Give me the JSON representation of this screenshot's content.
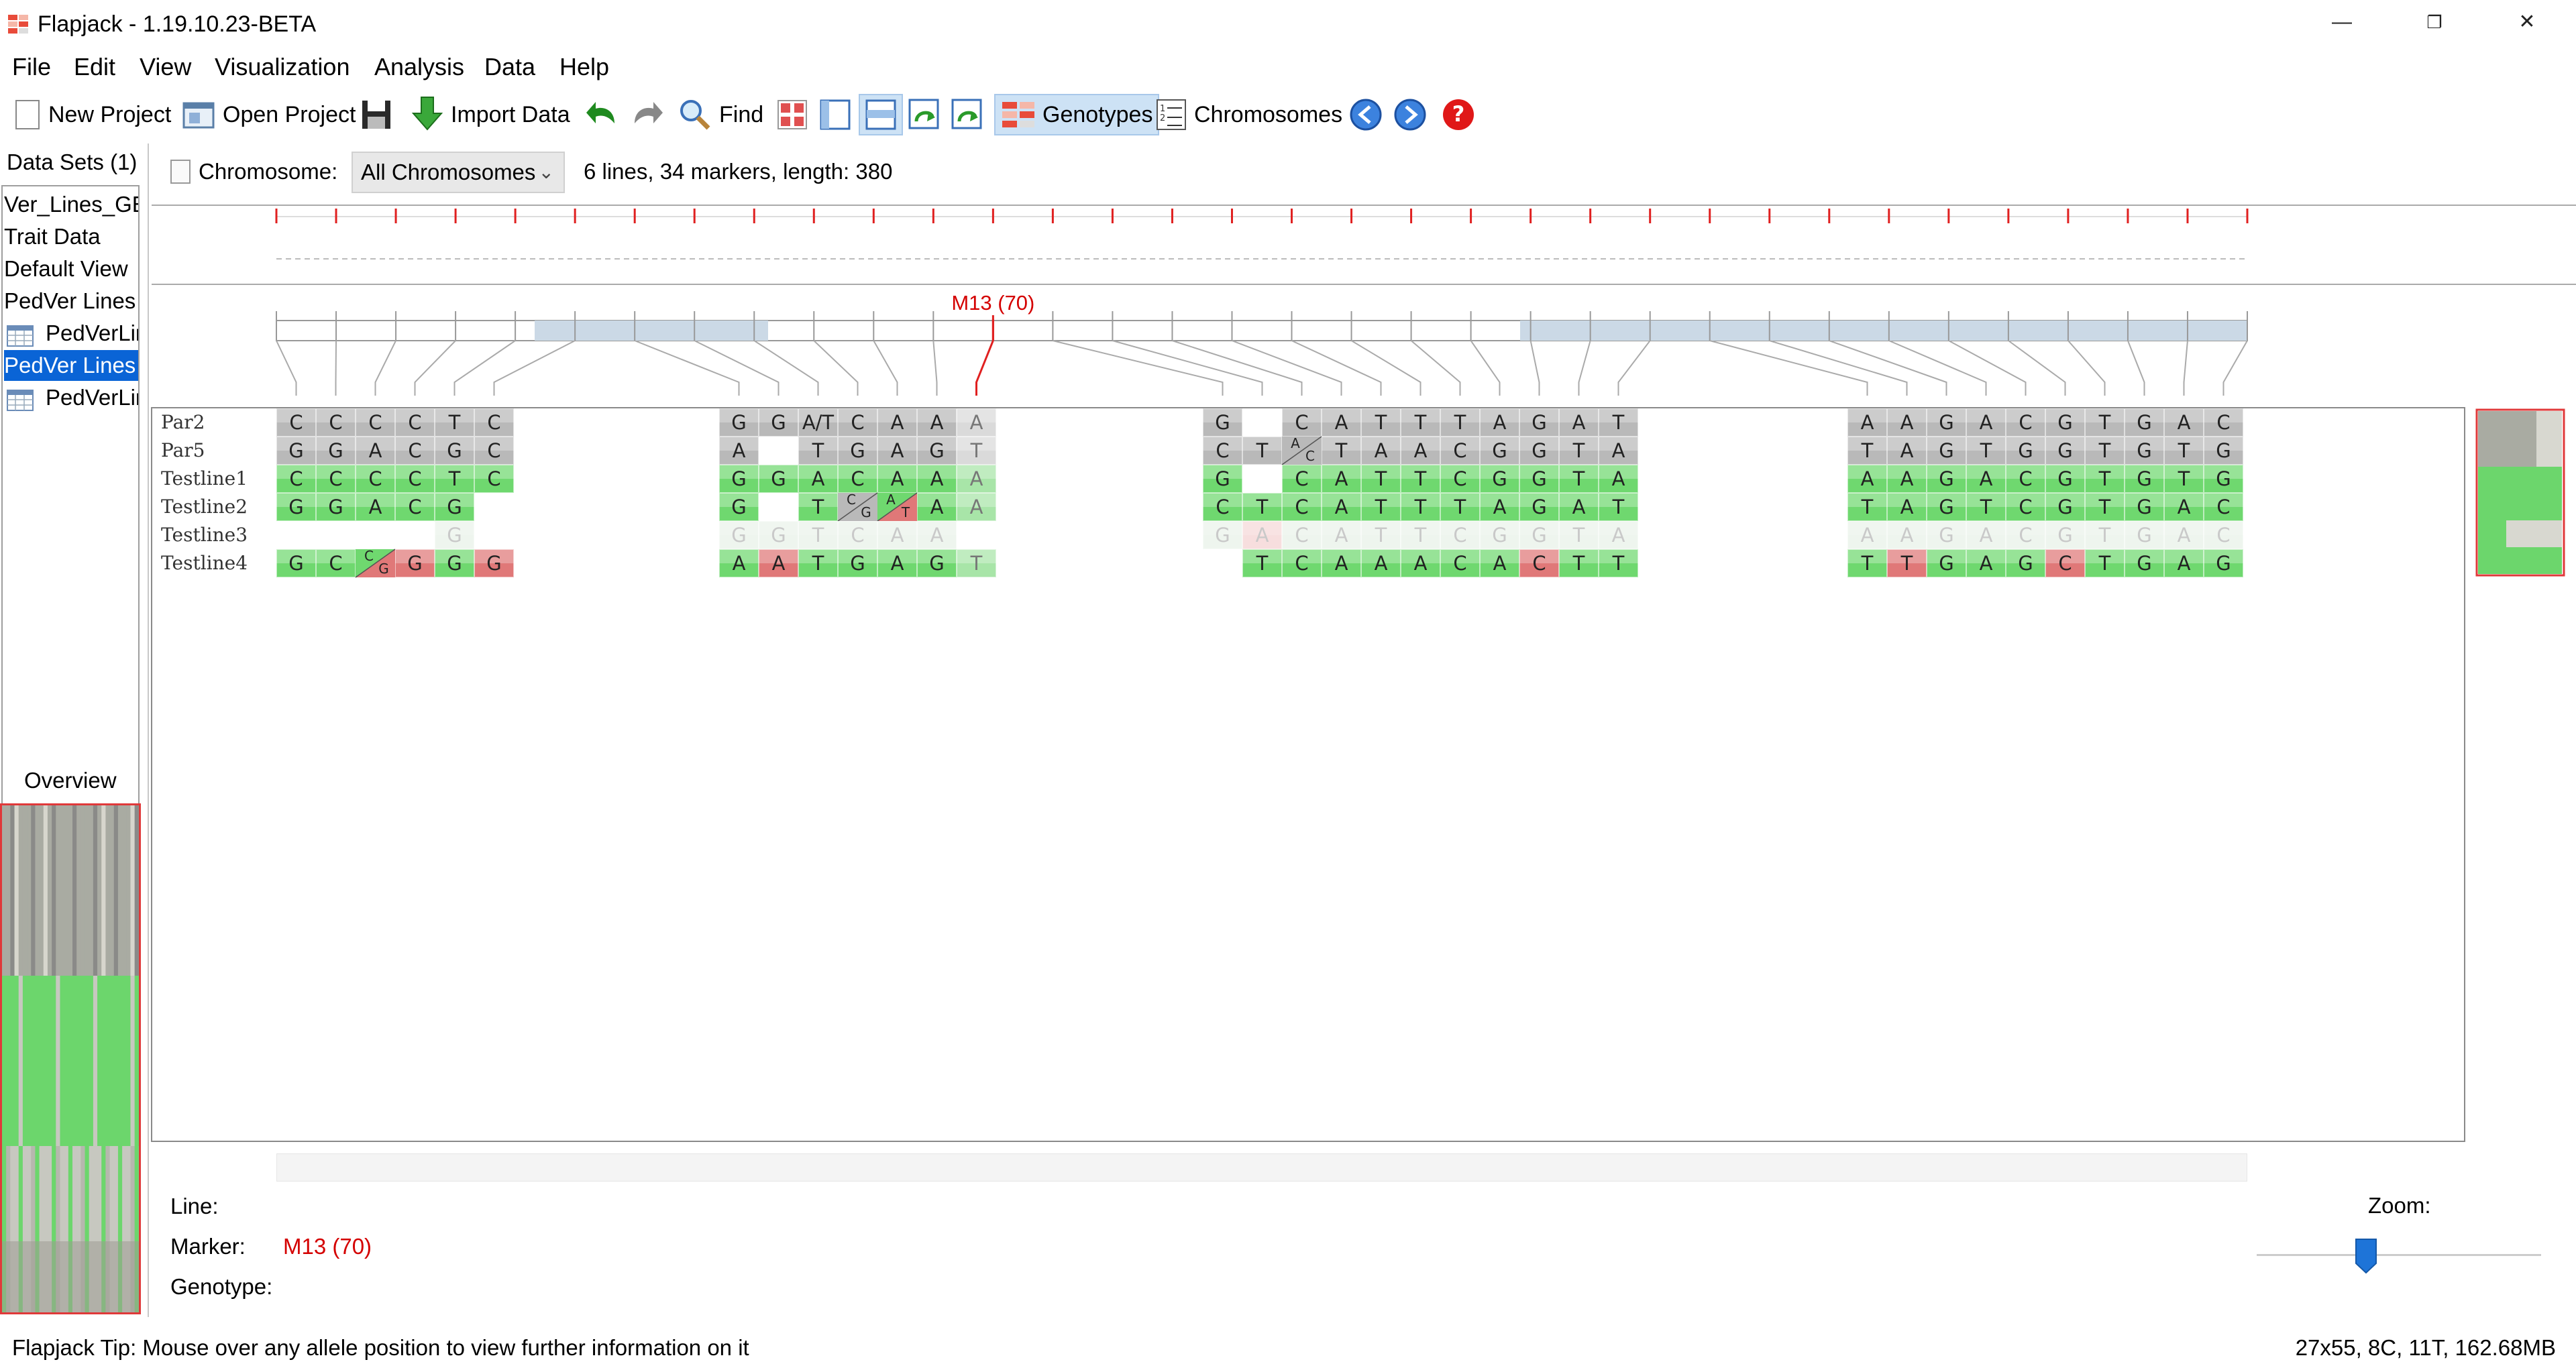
{
  "window": {
    "title": "Flapjack - 1.19.10.23-BETA",
    "controls": [
      "—",
      "❐",
      "✕"
    ]
  },
  "menu": [
    "File",
    "Edit",
    "View",
    "Visualization",
    "Analysis",
    "Data",
    "Help"
  ],
  "toolbar": {
    "new_project": "New Project",
    "open_project": "Open Project",
    "import_data": "Import Data",
    "find": "Find",
    "genotypes": "Genotypes",
    "chromosomes": "Chromosomes"
  },
  "datasets": {
    "title": "Data Sets (1)",
    "items": [
      {
        "label": "Ver_Lines_GEN",
        "icon": "none"
      },
      {
        "label": "Trait Data",
        "icon": "none"
      },
      {
        "label": "Default View",
        "icon": "none"
      },
      {
        "label": "PedVer Lines V",
        "icon": "none"
      },
      {
        "label": "PedVerLin",
        "icon": "table-icon"
      },
      {
        "label": "PedVer Lines V",
        "icon": "none",
        "selected": true
      },
      {
        "label": "PedVerLin",
        "icon": "table-icon"
      }
    ],
    "overview_title": "Overview"
  },
  "chromosome": {
    "label": "Chromosome:",
    "selected": "All Chromosomes",
    "info": "6 lines, 34 markers, length: 380"
  },
  "highlight_marker": {
    "label": "M13  (70)",
    "name": "M13",
    "position": 70
  },
  "lines": [
    "Par2",
    "Par5",
    "Testline1",
    "Testline2",
    "Testline3",
    "Testline4"
  ],
  "blocks": [
    {
      "columns": 6,
      "rows": [
        [
          "C",
          "C",
          "C",
          "C",
          "T",
          "C"
        ],
        [
          "G",
          "G",
          "A",
          "C",
          "G",
          "C"
        ],
        [
          "C",
          "C",
          "C",
          "C",
          "T",
          "C"
        ],
        [
          "G",
          "G",
          "A",
          "C",
          "G",
          ""
        ],
        [
          "",
          "",
          "",
          "",
          "G",
          ""
        ],
        [
          "G",
          "C",
          "C/G",
          "G",
          "G",
          "G"
        ]
      ],
      "states": [
        [
          "p",
          "p",
          "p",
          "p",
          "p",
          "p"
        ],
        [
          "p",
          "p",
          "p",
          "p",
          "p",
          "p"
        ],
        [
          "g",
          "g",
          "g",
          "g",
          "g",
          "g"
        ],
        [
          "g",
          "g",
          "g",
          "g",
          "g",
          "n"
        ],
        [
          "n",
          "n",
          "n",
          "n",
          "f",
          "n"
        ],
        [
          "g",
          "g",
          "h",
          "r",
          "g",
          "r"
        ]
      ]
    },
    {
      "columns": 7,
      "rows": [
        [
          "G",
          "G",
          "A/T",
          "C",
          "A",
          "A",
          "A"
        ],
        [
          "A",
          "",
          "T",
          "G",
          "A",
          "G",
          "T"
        ],
        [
          "G",
          "G",
          "A",
          "C",
          "A",
          "A",
          "A"
        ],
        [
          "G",
          "",
          "T",
          "C/G",
          "A/T",
          "A",
          "A"
        ],
        [
          "G",
          "G",
          "T",
          "C",
          "A",
          "A",
          ""
        ],
        [
          "A",
          "A",
          "T",
          "G",
          "A",
          "G",
          "T"
        ]
      ],
      "states": [
        [
          "p",
          "p",
          "p",
          "p",
          "p",
          "p",
          "q"
        ],
        [
          "p",
          "n",
          "p",
          "p",
          "p",
          "p",
          "q"
        ],
        [
          "g",
          "g",
          "g",
          "g",
          "g",
          "g",
          "l"
        ],
        [
          "g",
          "n",
          "g",
          "v",
          "h",
          "g",
          "l"
        ],
        [
          "f",
          "f",
          "f",
          "f",
          "f",
          "f",
          "n"
        ],
        [
          "g",
          "r",
          "g",
          "g",
          "g",
          "g",
          "l"
        ]
      ]
    },
    {
      "columns": 11,
      "rows": [
        [
          "G",
          "",
          "C",
          "A",
          "T",
          "T",
          "T",
          "A",
          "G",
          "A",
          "T"
        ],
        [
          "C",
          "T",
          "A/C",
          "T",
          "A",
          "A",
          "C",
          "G",
          "G",
          "T",
          "A"
        ],
        [
          "G",
          "",
          "C",
          "A",
          "T",
          "T",
          "C",
          "G",
          "G",
          "T",
          "A"
        ],
        [
          "C",
          "T",
          "C",
          "A",
          "T",
          "T",
          "T",
          "A",
          "G",
          "A",
          "T"
        ],
        [
          "G",
          "A",
          "C",
          "A",
          "T",
          "T",
          "C",
          "G",
          "G",
          "T",
          "A"
        ],
        [
          "",
          "T",
          "C",
          "A",
          "A",
          "A",
          "C",
          "A",
          "C",
          "T",
          "T"
        ]
      ],
      "states": [
        [
          "p",
          "n",
          "p",
          "p",
          "p",
          "p",
          "p",
          "p",
          "p",
          "p",
          "p"
        ],
        [
          "p",
          "p",
          "v",
          "p",
          "p",
          "p",
          "p",
          "p",
          "p",
          "p",
          "p"
        ],
        [
          "g",
          "n",
          "g",
          "g",
          "g",
          "g",
          "g",
          "g",
          "g",
          "g",
          "g"
        ],
        [
          "g",
          "g",
          "g",
          "g",
          "g",
          "g",
          "g",
          "g",
          "g",
          "g",
          "g"
        ],
        [
          "f",
          "e",
          "f",
          "f",
          "f",
          "f",
          "f",
          "f",
          "f",
          "f",
          "f"
        ],
        [
          "n",
          "g",
          "g",
          "g",
          "g",
          "g",
          "g",
          "g",
          "r",
          "g",
          "g"
        ]
      ]
    },
    {
      "columns": 10,
      "rows": [
        [
          "A",
          "A",
          "G",
          "A",
          "C",
          "G",
          "T",
          "G",
          "A",
          "C"
        ],
        [
          "T",
          "A",
          "G",
          "T",
          "G",
          "G",
          "T",
          "G",
          "T",
          "G"
        ],
        [
          "A",
          "A",
          "G",
          "A",
          "C",
          "G",
          "T",
          "G",
          "T",
          "G"
        ],
        [
          "T",
          "A",
          "G",
          "T",
          "C",
          "G",
          "T",
          "G",
          "A",
          "C"
        ],
        [
          "A",
          "A",
          "G",
          "A",
          "C",
          "G",
          "T",
          "G",
          "A",
          "C"
        ],
        [
          "T",
          "T",
          "G",
          "A",
          "G",
          "C",
          "T",
          "G",
          "A",
          "G"
        ]
      ],
      "states": [
        [
          "p",
          "p",
          "p",
          "p",
          "p",
          "p",
          "p",
          "p",
          "p",
          "p"
        ],
        [
          "p",
          "p",
          "p",
          "p",
          "p",
          "p",
          "p",
          "p",
          "p",
          "p"
        ],
        [
          "g",
          "g",
          "g",
          "g",
          "g",
          "g",
          "g",
          "g",
          "g",
          "g"
        ],
        [
          "g",
          "g",
          "g",
          "g",
          "g",
          "g",
          "g",
          "g",
          "g",
          "g"
        ],
        [
          "f",
          "f",
          "f",
          "f",
          "f",
          "f",
          "f",
          "f",
          "f",
          "f"
        ],
        [
          "g",
          "r",
          "g",
          "g",
          "g",
          "r",
          "g",
          "g",
          "g",
          "g"
        ]
      ]
    }
  ],
  "info_panel": {
    "line_label": "Line:",
    "marker_label": "Marker:",
    "marker_value": "M13 (70)",
    "genotype_label": "Genotype:",
    "zoom_label": "Zoom:"
  },
  "status": {
    "tip": "Flapjack Tip: Mouse over any allele position to view further information on it",
    "memory": "27x55, 8C, 11T, 162.68MB"
  },
  "colors": {
    "parent_gray": "#b9b9b9",
    "match_green": "#6fd86f",
    "mismatch_red": "#e07878",
    "faded": "#eef5ee",
    "highlight_red": "#e02020",
    "selection_blue": "#0a64d6"
  }
}
